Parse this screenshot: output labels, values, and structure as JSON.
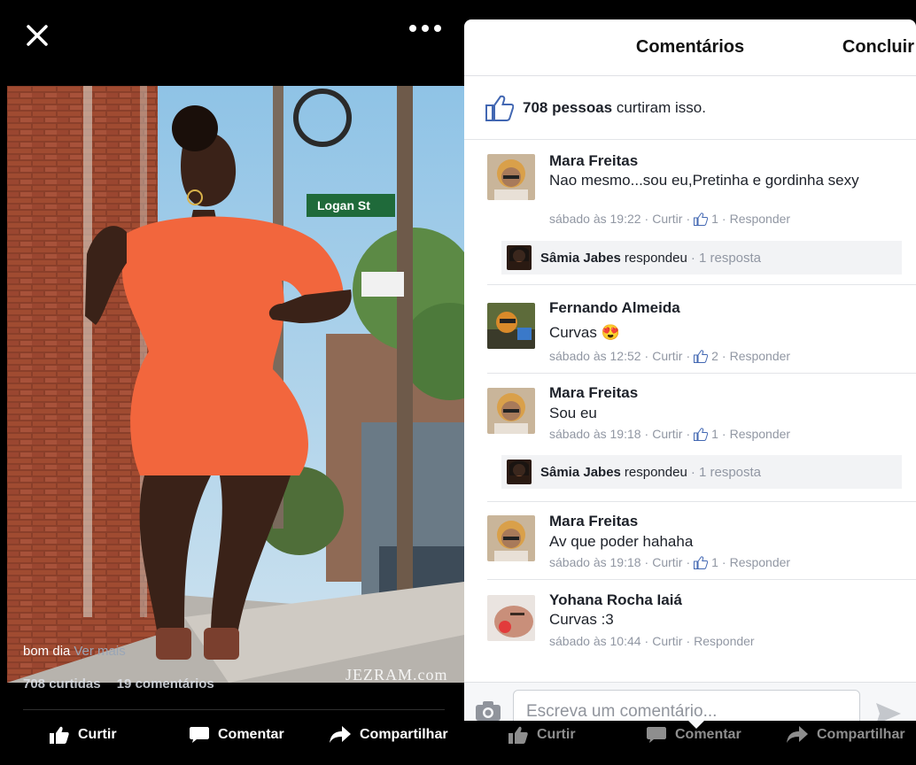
{
  "photo_view": {
    "caption_text": "bom dia",
    "caption_more": "Ver mais",
    "watermark": "JEZRAM.com",
    "likes_count": "708 curtidas",
    "comments_count": "19 comentários",
    "street_sign": "Logan St",
    "actions": {
      "like": "Curtir",
      "comment": "Comentar",
      "share": "Compartilhar"
    }
  },
  "comments_panel": {
    "title": "Comentários",
    "done_label": "Concluir",
    "likes_summary_bold": "708 pessoas",
    "likes_summary_rest": "curtiram isso.",
    "comments": [
      {
        "name": "Mara Freitas",
        "text": "Nao mesmo...sou eu,Pretinha e gordinha sexy",
        "time": "sábado às 19:22",
        "like_label": "Curtir",
        "likes": "1",
        "reply_label": "Responder"
      },
      {
        "name": "Fernando Almeida",
        "text": "Curvas",
        "emoji": "😍",
        "time": "sábado às 12:52",
        "like_label": "Curtir",
        "likes": "2",
        "reply_label": "Responder"
      },
      {
        "name": "Mara Freitas",
        "text": "Sou eu",
        "time": "sábado às 19:18",
        "like_label": "Curtir",
        "likes": "1",
        "reply_label": "Responder"
      },
      {
        "name": "Mara Freitas",
        "text": "Av que poder hahaha",
        "time": "sábado às 19:18",
        "like_label": "Curtir",
        "likes": "1",
        "reply_label": "Responder"
      },
      {
        "name": "Yohana Rocha Iaiá",
        "text": "Curvas :3",
        "time": "sábado às 10:44",
        "like_label": "Curtir",
        "reply_label": "Responder"
      }
    ],
    "replies": [
      {
        "name": "Sâmia Jabes",
        "verb": "respondeu",
        "count": "1 resposta"
      },
      {
        "name": "Sâmia Jabes",
        "verb": "respondeu",
        "count": "1 resposta"
      }
    ],
    "composer_placeholder": "Escreva um comentário...",
    "actions": {
      "like": "Curtir",
      "comment": "Comentar",
      "share": "Compartilhar"
    }
  }
}
